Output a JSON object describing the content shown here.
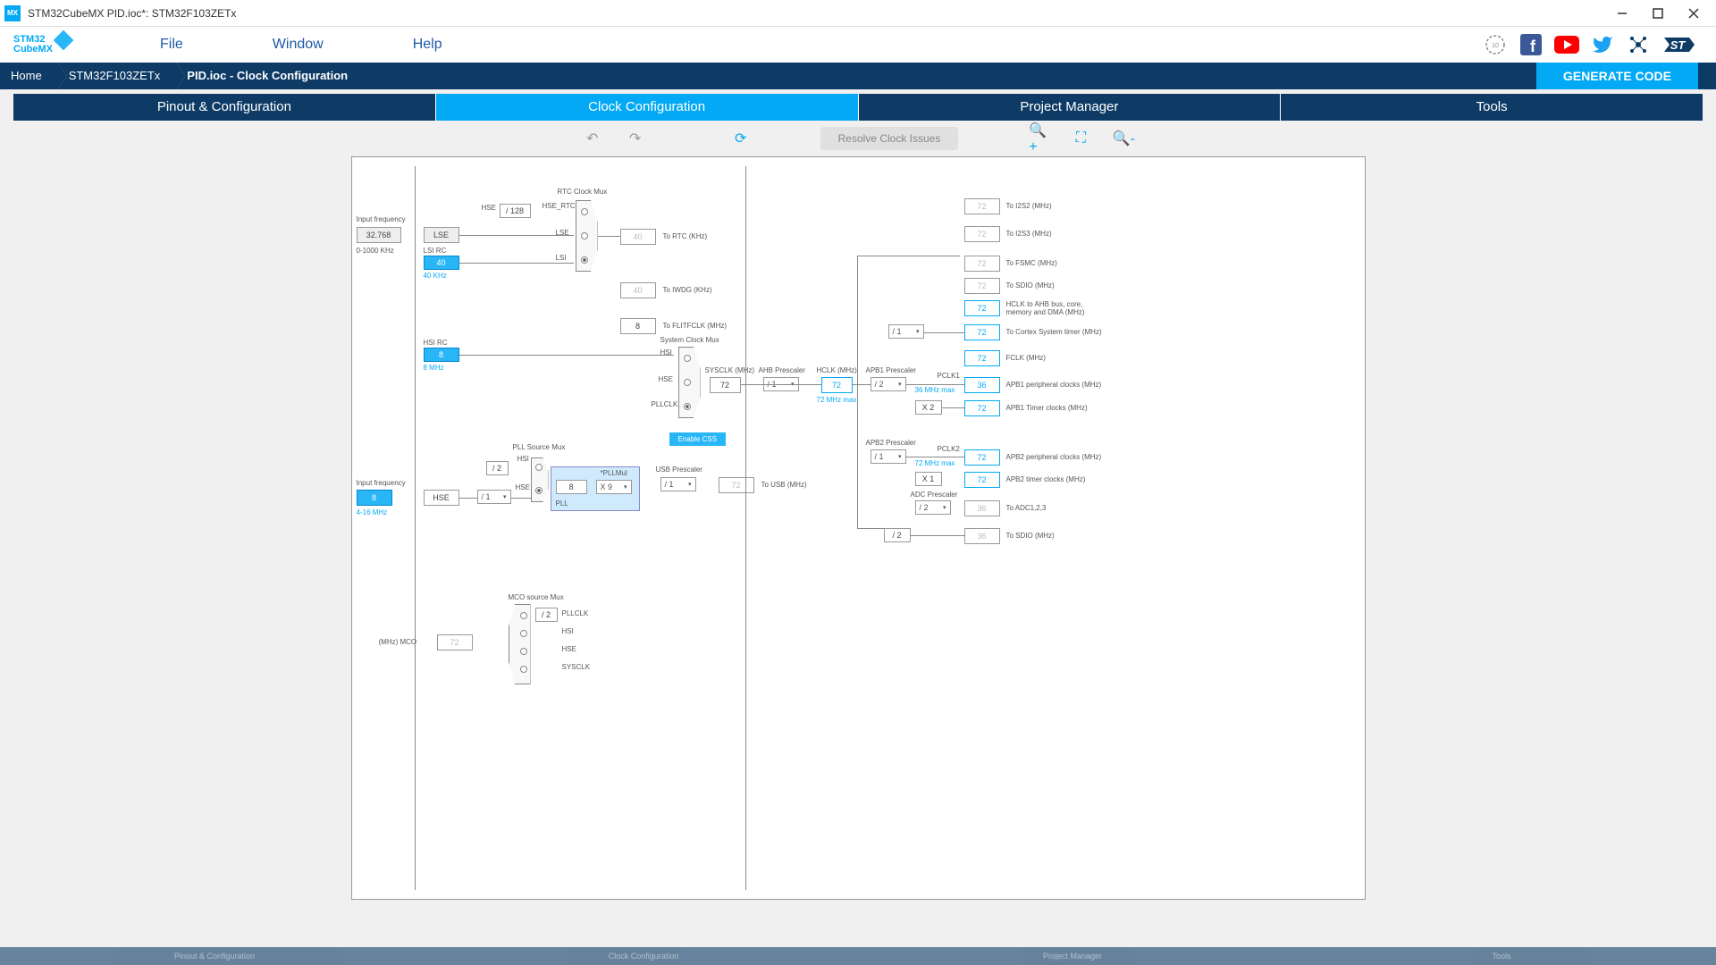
{
  "title": "STM32CubeMX PID.ioc*: STM32F103ZETx",
  "app_badge": "MX",
  "logo": {
    "line1": "STM32",
    "line2": "CubeMX"
  },
  "menu": {
    "file": "File",
    "window": "Window",
    "help": "Help"
  },
  "breadcrumb": {
    "home": "Home",
    "device": "STM32F103ZETx",
    "page": "PID.ioc - Clock Configuration"
  },
  "generate": "GENERATE CODE",
  "tabs": {
    "pinout": "Pinout & Configuration",
    "clock": "Clock Configuration",
    "project": "Project Manager",
    "tools": "Tools"
  },
  "toolbar": {
    "resolve": "Resolve Clock Issues"
  },
  "clk": {
    "lse": {
      "label": "LSE",
      "input_freq_label": "Input frequency",
      "value": "32.768",
      "range": "0-1000 KHz"
    },
    "lsi": {
      "label": "LSI RC",
      "value": "40",
      "note": "40 KHz"
    },
    "hsi": {
      "label": "HSI RC",
      "value": "8",
      "note": "8 MHz"
    },
    "hse": {
      "label": "HSE",
      "input_freq_label": "Input frequency",
      "value": "8",
      "range": "4-16 MHz",
      "div": "/ 1"
    },
    "rtc_mux": {
      "title": "RTC Clock Mux",
      "div128": "/ 128",
      "hse": "HSE",
      "hse_rtc": "HSE_RTC",
      "lse_l": "LSE",
      "lsi_l": "LSI",
      "out_val": "40",
      "out_label": "To RTC (KHz)"
    },
    "iwdg": {
      "val": "40",
      "label": "To IWDG (KHz)"
    },
    "flitf": {
      "val": "8",
      "label": "To FLITFCLK (MHz)"
    },
    "sysmux": {
      "title": "System Clock Mux",
      "hsi": "HSI",
      "hse": "HSE",
      "pllclk": "PLLCLK"
    },
    "css": "Enable CSS",
    "pllmux": {
      "title": "PLL Source Mux",
      "div2": "/ 2",
      "hsi": "HSI",
      "hse": "HSE"
    },
    "pll": {
      "title": "PLL",
      "mul_label": "*PLLMul",
      "in": "8",
      "mul": "X 9"
    },
    "sysclk": {
      "label": "SYSCLK (MHz)",
      "val": "72"
    },
    "ahb": {
      "label": "AHB Prescaler",
      "val": "/ 1"
    },
    "hclk": {
      "label": "HCLK (MHz)",
      "val": "72",
      "max": "72 MHz max"
    },
    "apb1": {
      "label": "APB1 Prescaler",
      "val": "/ 2",
      "pclk1": "PCLK1",
      "max": "36 MHz max",
      "periph_val": "36",
      "periph": "APB1 peripheral clocks (MHz)",
      "tim_mul": "X 2",
      "tim_val": "72",
      "tim": "APB1 Timer clocks (MHz)"
    },
    "apb2": {
      "label": "APB2 Prescaler",
      "val": "/ 1",
      "pclk2": "PCLK2",
      "max": "72 MHz max",
      "periph_val": "72",
      "periph": "APB2 peripheral clocks (MHz)",
      "tim_mul": "X 1",
      "tim_val": "72",
      "tim": "APB2 timer clocks (MHz)"
    },
    "adc": {
      "label": "ADC Prescaler",
      "val": "/ 2",
      "out_val": "36",
      "out": "To ADC1,2,3"
    },
    "usb": {
      "label": "USB Prescaler",
      "val": "/ 1",
      "out_val": "72",
      "out": "To USB (MHz)"
    },
    "outs": {
      "i2s2": {
        "val": "72",
        "lbl": "To I2S2 (MHz)"
      },
      "i2s3": {
        "val": "72",
        "lbl": "To I2S3 (MHz)"
      },
      "fsmc": {
        "val": "72",
        "lbl": "To FSMC (MHz)"
      },
      "sdio": {
        "val": "72",
        "lbl": "To SDIO (MHz)"
      },
      "hclk_ahb": {
        "val": "72",
        "lbl": "HCLK to AHB bus, core, memory and DMA (MHz)"
      },
      "cortex": {
        "div": "/ 1",
        "val": "72",
        "lbl": "To Cortex System timer (MHz)"
      },
      "fclk": {
        "val": "72",
        "lbl": "FCLK (MHz)"
      },
      "sdio2": {
        "div": "/ 2",
        "val": "36",
        "lbl": "To SDIO (MHz)"
      }
    },
    "mco": {
      "title": "MCO source Mux",
      "div2": "/ 2",
      "pllclk": "PLLCLK",
      "hsi": "HSI",
      "hse": "HSE",
      "sysclk": "SYSCLK",
      "out_val": "72",
      "out_lbl": "(MHz) MCO"
    }
  }
}
